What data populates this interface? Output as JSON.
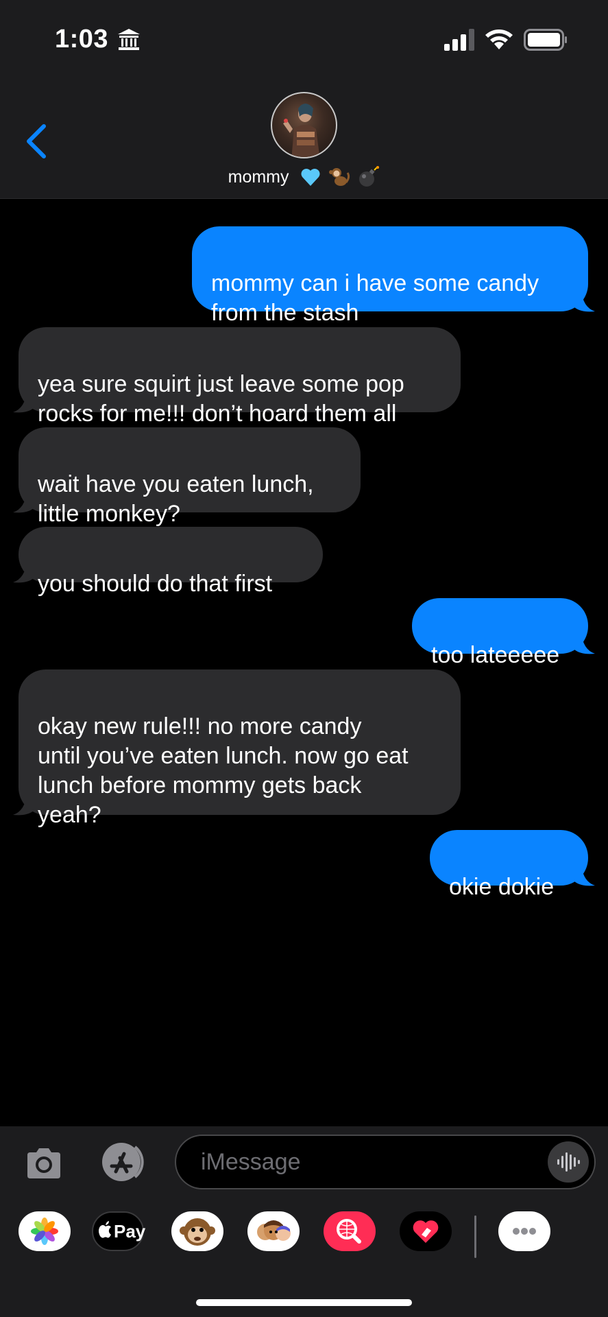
{
  "status_bar": {
    "time": "1:03",
    "icons": [
      "bank-icon",
      "cellular-signal-icon",
      "wifi-icon",
      "battery-icon"
    ]
  },
  "header": {
    "contact_name": "mommy",
    "name_emojis": [
      "💙",
      "🐒",
      "💣"
    ],
    "back_icon": "chevron-left-icon"
  },
  "colors": {
    "outgoing_bubble": "#0a84ff",
    "incoming_bubble": "#2c2c2e",
    "background": "#000000",
    "accent": "#0a84ff"
  },
  "messages": [
    {
      "direction": "out",
      "text": "mommy can i have some candy\nfrom the stash"
    },
    {
      "direction": "in",
      "text": "yea sure squirt just leave some pop\nrocks for me!!! don’t hoard them all"
    },
    {
      "direction": "in",
      "text": "wait have you eaten lunch,\nlittle monkey?"
    },
    {
      "direction": "in",
      "text": "you should do that first"
    },
    {
      "direction": "out",
      "text": "too lateeeee"
    },
    {
      "direction": "in",
      "text": "okay new rule!!! no more candy\nuntil you’ve eaten lunch. now go eat\nlunch before mommy gets back\nyeah?"
    },
    {
      "direction": "out",
      "text": "okie dokie"
    }
  ],
  "composer": {
    "placeholder": "iMessage",
    "icons": [
      "camera-icon",
      "app-store-icon",
      "audio-waveform-icon"
    ]
  },
  "app_strip": {
    "apps": [
      "photos-app-icon",
      "apple-pay-app-icon",
      "memoji-monkey-app-icon",
      "memoji-app-icon",
      "image-search-app-icon",
      "digital-touch-app-icon",
      "more-apps-icon"
    ],
    "apple_pay_label": "Pay"
  }
}
